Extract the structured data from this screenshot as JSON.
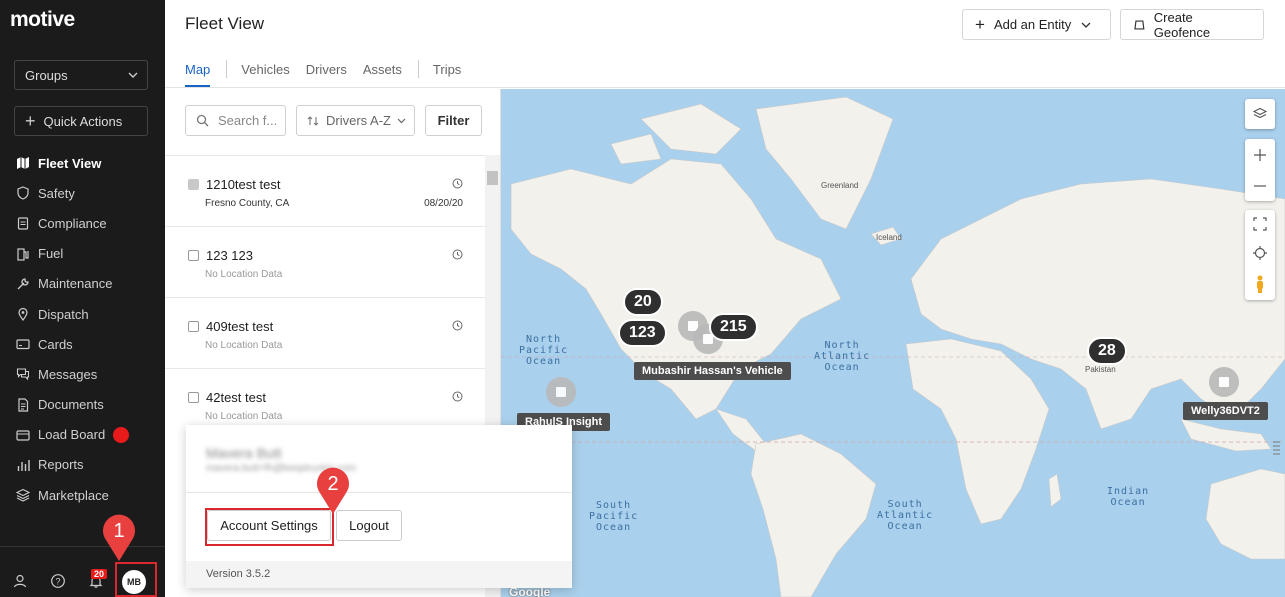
{
  "app": {
    "logo": "motive"
  },
  "sidebar": {
    "groups_label": "Groups",
    "quick_actions_label": "Quick Actions",
    "items": [
      {
        "label": "Fleet View",
        "icon": "map-icon",
        "active": true
      },
      {
        "label": "Safety",
        "icon": "shield-icon"
      },
      {
        "label": "Compliance",
        "icon": "clipboard-icon"
      },
      {
        "label": "Fuel",
        "icon": "fuel-pump-icon"
      },
      {
        "label": "Maintenance",
        "icon": "wrench-icon"
      },
      {
        "label": "Dispatch",
        "icon": "location-pin-icon"
      },
      {
        "label": "Cards",
        "icon": "card-icon"
      },
      {
        "label": "Messages",
        "icon": "chat-icon"
      },
      {
        "label": "Documents",
        "icon": "document-icon"
      },
      {
        "label": "Load Board",
        "icon": "truck-icon"
      },
      {
        "label": "Reports",
        "icon": "bar-chart-icon"
      },
      {
        "label": "Marketplace",
        "icon": "layers-icon"
      }
    ],
    "notification_count": "20",
    "avatar_initials": "MB"
  },
  "header": {
    "title": "Fleet View",
    "add_entity_label": "Add an Entity",
    "create_geofence_label": "Create Geofence",
    "tabs": [
      "Map",
      "Vehicles",
      "Drivers",
      "Assets",
      "Trips"
    ]
  },
  "panel": {
    "search_placeholder": "Search f...",
    "sort_label": "Drivers A-Z",
    "filter_label": "Filter",
    "rows": [
      {
        "name": "1210test test",
        "location": "Fresno County, CA",
        "date": "08/20/20"
      },
      {
        "name": "123 123",
        "location": "No Location Data",
        "date": ""
      },
      {
        "name": "409test test",
        "location": "No Location Data",
        "date": ""
      },
      {
        "name": "42test test",
        "location": "No Location Data",
        "date": ""
      }
    ]
  },
  "map": {
    "clusters": [
      "20",
      "123",
      "215",
      "28"
    ],
    "vehicle_labels": [
      "Mubashir Hassan's Vehicle",
      "RahulS Insight",
      "Welly36DVT2"
    ],
    "labels": {
      "greenland": "Greenland",
      "iceland": "Iceland",
      "pakistan": "Pakistan",
      "north_pacific": "North\nPacific\nOcean",
      "north_atlantic": "North\nAtlantic\nOcean",
      "south_pacific": "South\nPacific\nOcean",
      "south_atlantic": "South\nAtlantic\nOcean",
      "indian": "Indian\nOcean"
    },
    "attribution": "Google"
  },
  "popup": {
    "user_name": "Mavera Butt",
    "user_email": "mavera.butt+fh@keeptruckin.com",
    "account_settings_label": "Account Settings",
    "logout_label": "Logout",
    "version": "Version 3.5.2"
  },
  "callouts": [
    "1",
    "2"
  ],
  "colors": {
    "accent": "#1763c7",
    "sidebar_bg": "#1b1b1b",
    "callout_red": "#d9282e",
    "ocean": "#a9d0ec",
    "land": "#f3f1ec"
  }
}
